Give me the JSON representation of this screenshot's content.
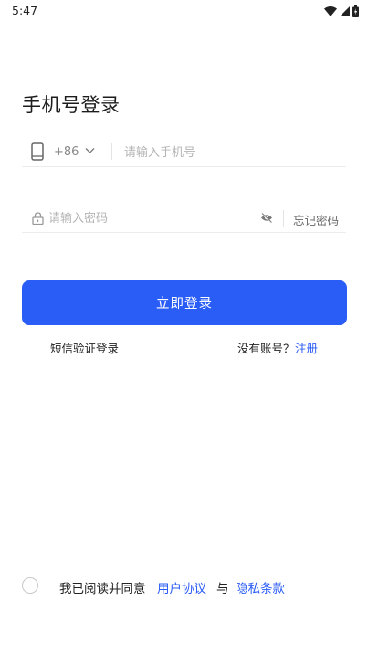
{
  "status_bar": {
    "time": "5:47",
    "icons": [
      "wifi-icon",
      "signal-icon",
      "battery-icon"
    ]
  },
  "page_title": "手机号登录",
  "phone": {
    "country_code": "+86",
    "placeholder": "请输入手机号",
    "value": ""
  },
  "password": {
    "placeholder": "请输入密码",
    "value": "",
    "forgot_label": "忘记密码"
  },
  "login_button": "立即登录",
  "sms_login": "短信验证登录",
  "no_account": "没有账号？",
  "register": "注册",
  "agreement": {
    "prefix": "我已阅读并同意",
    "user_agreement": "用户协议",
    "and": "与",
    "privacy": "隐私条款",
    "checked": false
  },
  "colors": {
    "accent": "#2a5cf6",
    "text": "#222222",
    "placeholder": "#b4b4b4"
  }
}
